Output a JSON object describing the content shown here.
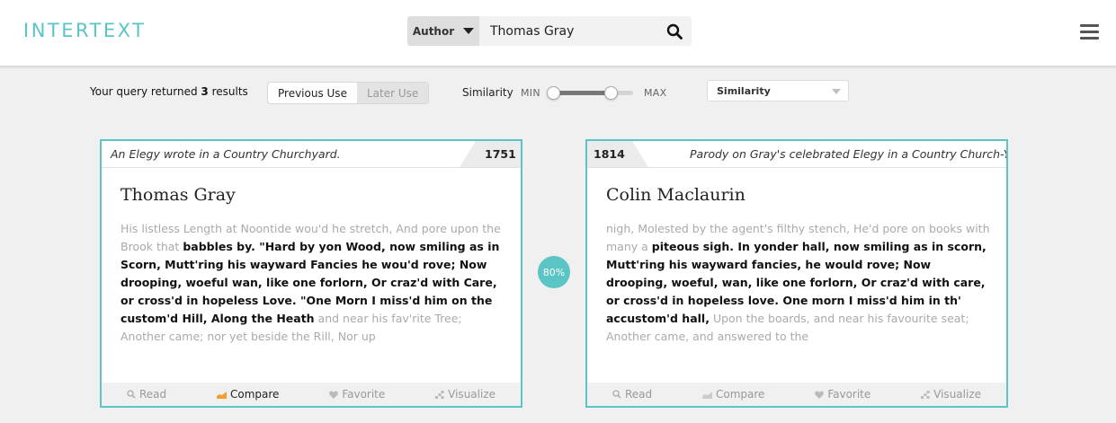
{
  "header": {
    "logo": "INTERTEXT",
    "search": {
      "type_label": "Author",
      "query": "Thomas Gray"
    }
  },
  "toolbar": {
    "result_prefix": "Your query returned",
    "result_count": "3",
    "result_suffix": "results",
    "toggle": [
      {
        "label": "Previous Use",
        "active": true
      },
      {
        "label": "Later Use",
        "active": false
      }
    ],
    "similarity_label": "Similarity",
    "slider_min_label": "MIN",
    "slider_max_label": "MAX",
    "slider_value": 0.75,
    "sort_label": "Similarity"
  },
  "match_badge": "80%",
  "cards": [
    {
      "title": "An Elegy wrote in a Country Churchyard.",
      "year": "1751",
      "author": "Thomas Gray",
      "text_before": "His listless Length at Noontide wou'd he stretch, And pore upon the Brook that ",
      "text_match": "babbles by. \"Hard by yon Wood, now smiling as in Scorn, Mutt'ring his wayward Fancies he wou'd rove; Now drooping, woeful wan, like one forlorn, Or craz'd with Care, or cross'd in hopeless Love. \"One Morn I miss'd him on the custom'd Hill, Along the Heath",
      "text_after": " and near his fav'rite Tree; Another came; nor yet beside the Rill, Nor up",
      "actions": {
        "read": "Read",
        "compare": "Compare",
        "favorite": "Favorite",
        "visualize": "Visualize"
      }
    },
    {
      "title": "Parody on Gray's celebrated Elegy in a Country Church-Yard",
      "year": "1814",
      "author": "Colin Maclaurin",
      "text_before": "nigh, Molested by the agent's filthy stench, He'd pore on books with many a ",
      "text_match": "piteous sigh. In yonder hall, now smiling as in scorn, Mutt'ring his wayward fancies, he would rove; Now drooping, woeful, wan, like one forlorn, Or craz'd with care, or cross'd in hopeless love. One morn I miss'd him in th' accustom'd hall,",
      "text_after": " Upon the boards, and near his favourite seat; Another came, and answered to the",
      "actions": {
        "read": "Read",
        "compare": "Compare",
        "favorite": "Favorite",
        "visualize": "Visualize"
      }
    }
  ],
  "colors": {
    "accent": "#5bc4c4",
    "compare_active": "#f0a030"
  }
}
